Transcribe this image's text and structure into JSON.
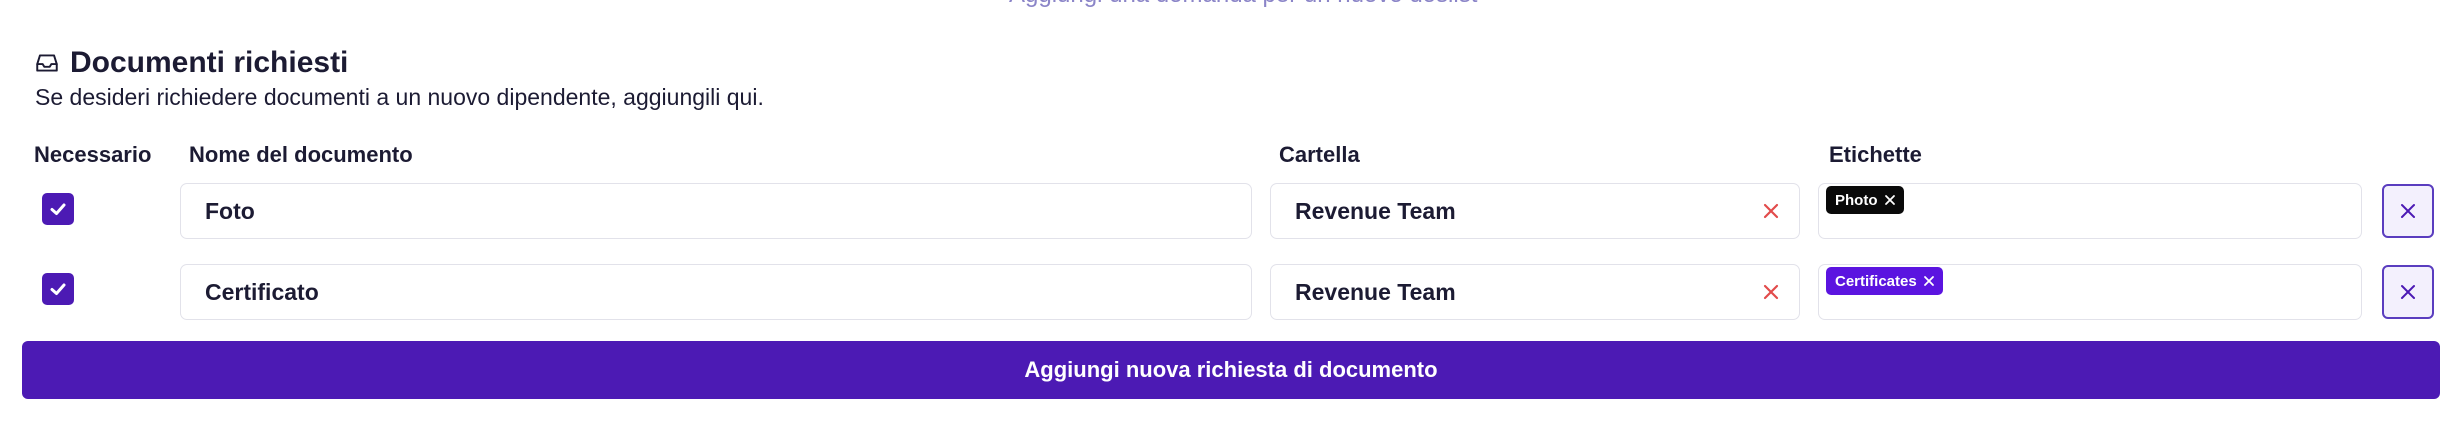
{
  "top_link": {
    "label": "Aggiungi una domanda per un nuovo dosiist"
  },
  "section": {
    "title": "Documenti richiesti",
    "subtitle": "Se desideri richiedere documenti a un nuovo dipendente, aggiungili qui.",
    "icon": "inbox-icon"
  },
  "columns": {
    "required": "Necessario",
    "name": "Nome del documento",
    "folder": "Cartella",
    "tags": "Etichette"
  },
  "rows": [
    {
      "required": true,
      "name": "Foto",
      "folder": "Revenue Team",
      "tag": {
        "label": "Photo",
        "color": "#0a0a0a"
      }
    },
    {
      "required": true,
      "name": "Certificato",
      "folder": "Revenue Team",
      "tag": {
        "label": "Certificates",
        "color": "#5b14e0"
      }
    }
  ],
  "add_button": {
    "label": "Aggiungi nuova richiesta di documento"
  },
  "colors": {
    "accent": "#4c1ab4",
    "clear": "#e24b4b",
    "text": "#1c1b33"
  }
}
